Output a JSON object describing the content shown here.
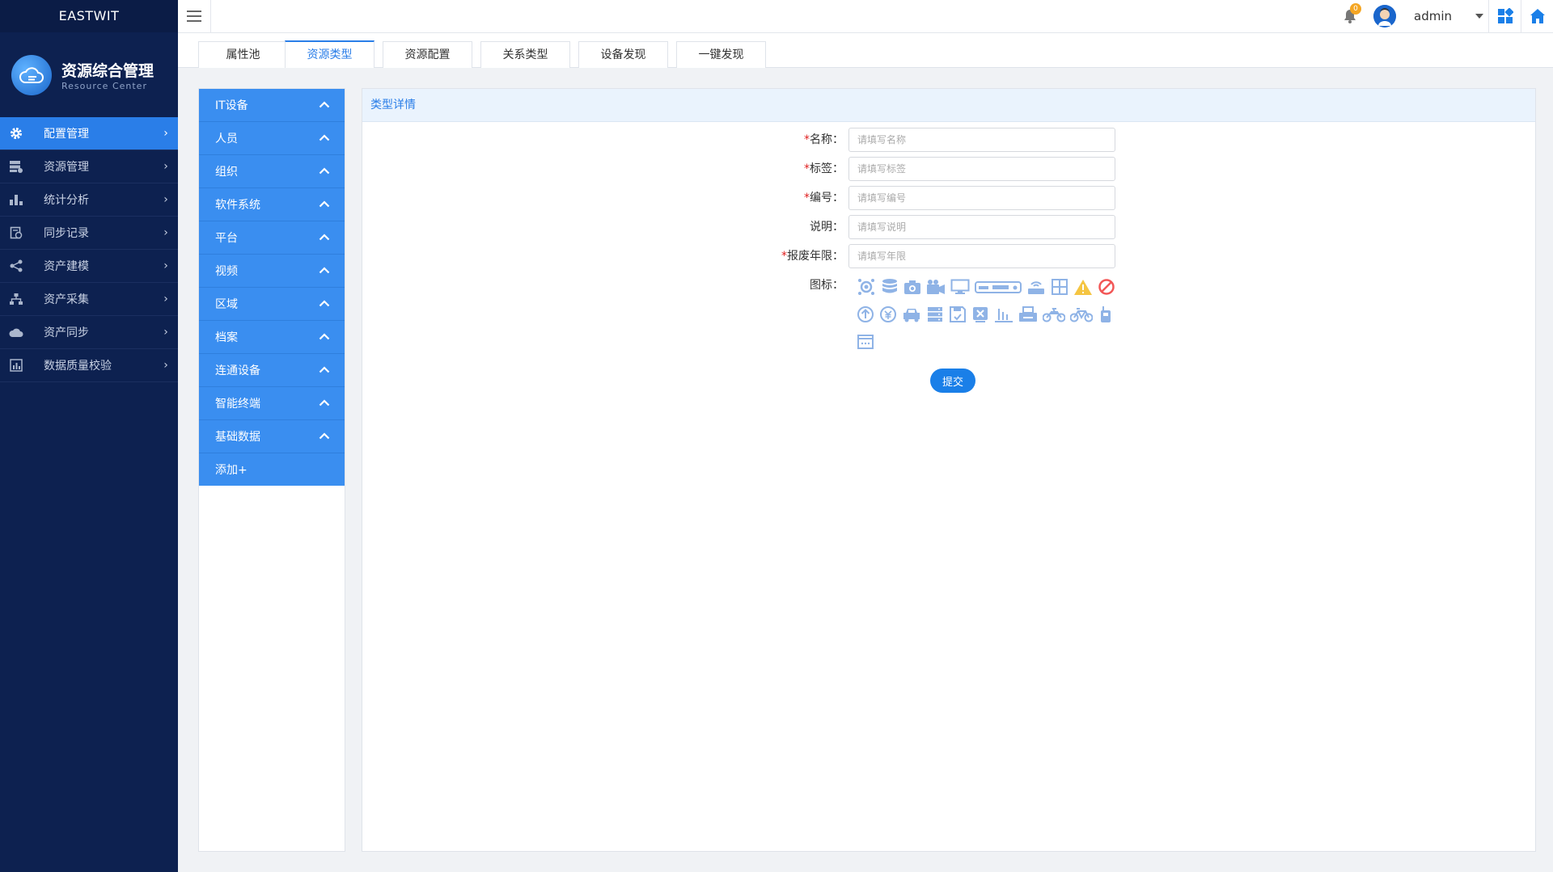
{
  "sidebar": {
    "brand": "EASTWIT",
    "logo_title": "资源综合管理",
    "logo_subtitle": "Resource Center",
    "items": [
      {
        "label": "配置管理",
        "icon": "gear-icon"
      },
      {
        "label": "资源管理",
        "icon": "server-icon"
      },
      {
        "label": "统计分析",
        "icon": "bar-chart-icon"
      },
      {
        "label": "同步记录",
        "icon": "record-icon"
      },
      {
        "label": "资产建模",
        "icon": "share-icon"
      },
      {
        "label": "资产采集",
        "icon": "sitemap-icon"
      },
      {
        "label": "资产同步",
        "icon": "cloud-icon"
      },
      {
        "label": "数据质量校验",
        "icon": "chart-box-icon"
      }
    ]
  },
  "header": {
    "notification_count": "0",
    "username": "admin"
  },
  "tabs": [
    "属性池",
    "资源类型",
    "资源配置",
    "关系类型",
    "设备发现",
    "一键发现"
  ],
  "categories": {
    "items": [
      "IT设备",
      "人员",
      "组织",
      "软件系统",
      "平台",
      "视频",
      "区域",
      "档案",
      "连通设备",
      "智能终端",
      "基础数据"
    ],
    "add_label": "添加+"
  },
  "detail": {
    "title": "类型详情",
    "fields": [
      {
        "label": "名称：",
        "required": true,
        "placeholder": "请填写名称"
      },
      {
        "label": "标签：",
        "required": true,
        "placeholder": "请填写标签"
      },
      {
        "label": "编号：",
        "required": true,
        "placeholder": "请填写编号"
      },
      {
        "label": "说明：",
        "required": false,
        "placeholder": "请填写说明"
      },
      {
        "label": "报废年限：",
        "required": true,
        "placeholder": "请填写年限"
      }
    ],
    "icon_label": "图标：",
    "icons": [
      "hub-icon",
      "database-icon",
      "camera-icon",
      "video-camera-icon",
      "monitor-icon",
      "rack-device-icon",
      "router-icon",
      "grid-icon",
      "warning-icon",
      "forbidden-icon",
      "arrow-up-circle-icon",
      "coin-icon",
      "car-icon",
      "server-icon",
      "floppy-check-icon",
      "screen-x-icon",
      "signal-bars-icon",
      "printer-icon",
      "motorbike-icon",
      "bicycle-icon",
      "walkie-talkie-icon",
      "window-icon"
    ],
    "submit_label": "提交"
  }
}
